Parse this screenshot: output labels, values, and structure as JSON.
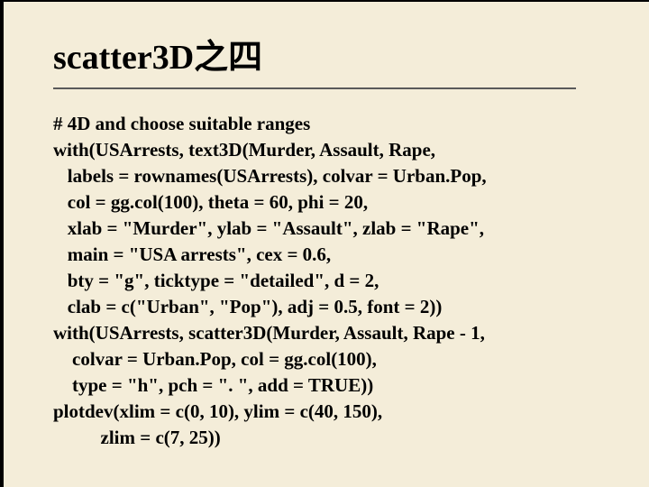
{
  "title": "scatter3D之四",
  "code_lines": [
    "# 4D and choose suitable ranges",
    "with(USArrests, text3D(Murder, Assault, Rape,",
    "   labels = rownames(USArrests), colvar = Urban.Pop,",
    "   col = gg.col(100), theta = 60, phi = 20,",
    "   xlab = \"Murder\", ylab = \"Assault\", zlab = \"Rape\",",
    "   main = \"USA arrests\", cex = 0.6,",
    "   bty = \"g\", ticktype = \"detailed\", d = 2,",
    "   clab = c(\"Urban\", \"Pop\"), adj = 0.5, font = 2))",
    "with(USArrests, scatter3D(Murder, Assault, Rape - 1,",
    "    colvar = Urban.Pop, col = gg.col(100),",
    "    type = \"h\", pch = \". \", add = TRUE))",
    "plotdev(xlim = c(0, 10), ylim = c(40, 150),",
    "          zlim = c(7, 25))"
  ]
}
